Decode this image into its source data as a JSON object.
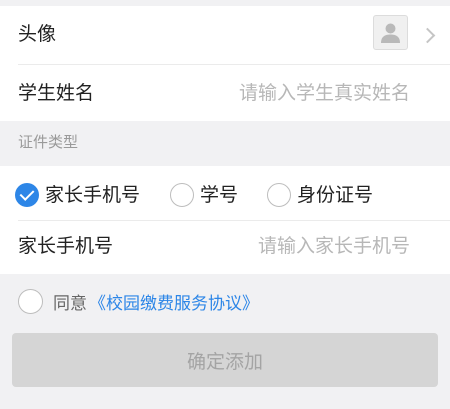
{
  "profile": {
    "avatar_label": "头像",
    "name_label": "学生姓名",
    "name_placeholder": "请输入学生真实姓名",
    "name_value": ""
  },
  "id_type": {
    "section_title": "证件类型",
    "options": [
      {
        "label": "家长手机号",
        "checked": true
      },
      {
        "label": "学号",
        "checked": false
      },
      {
        "label": "身份证号",
        "checked": false
      }
    ]
  },
  "phone": {
    "label": "家长手机号",
    "placeholder": "请输入家长手机号",
    "value": ""
  },
  "agreement": {
    "text": "同意",
    "link": "《校园缴费服务协议》",
    "checked": false
  },
  "submit": {
    "label": "确定添加"
  },
  "colors": {
    "accent": "#2d86e7",
    "button_bg": "#d5d5d5",
    "button_text": "#a4a4a4",
    "background": "#f1f1f3"
  }
}
